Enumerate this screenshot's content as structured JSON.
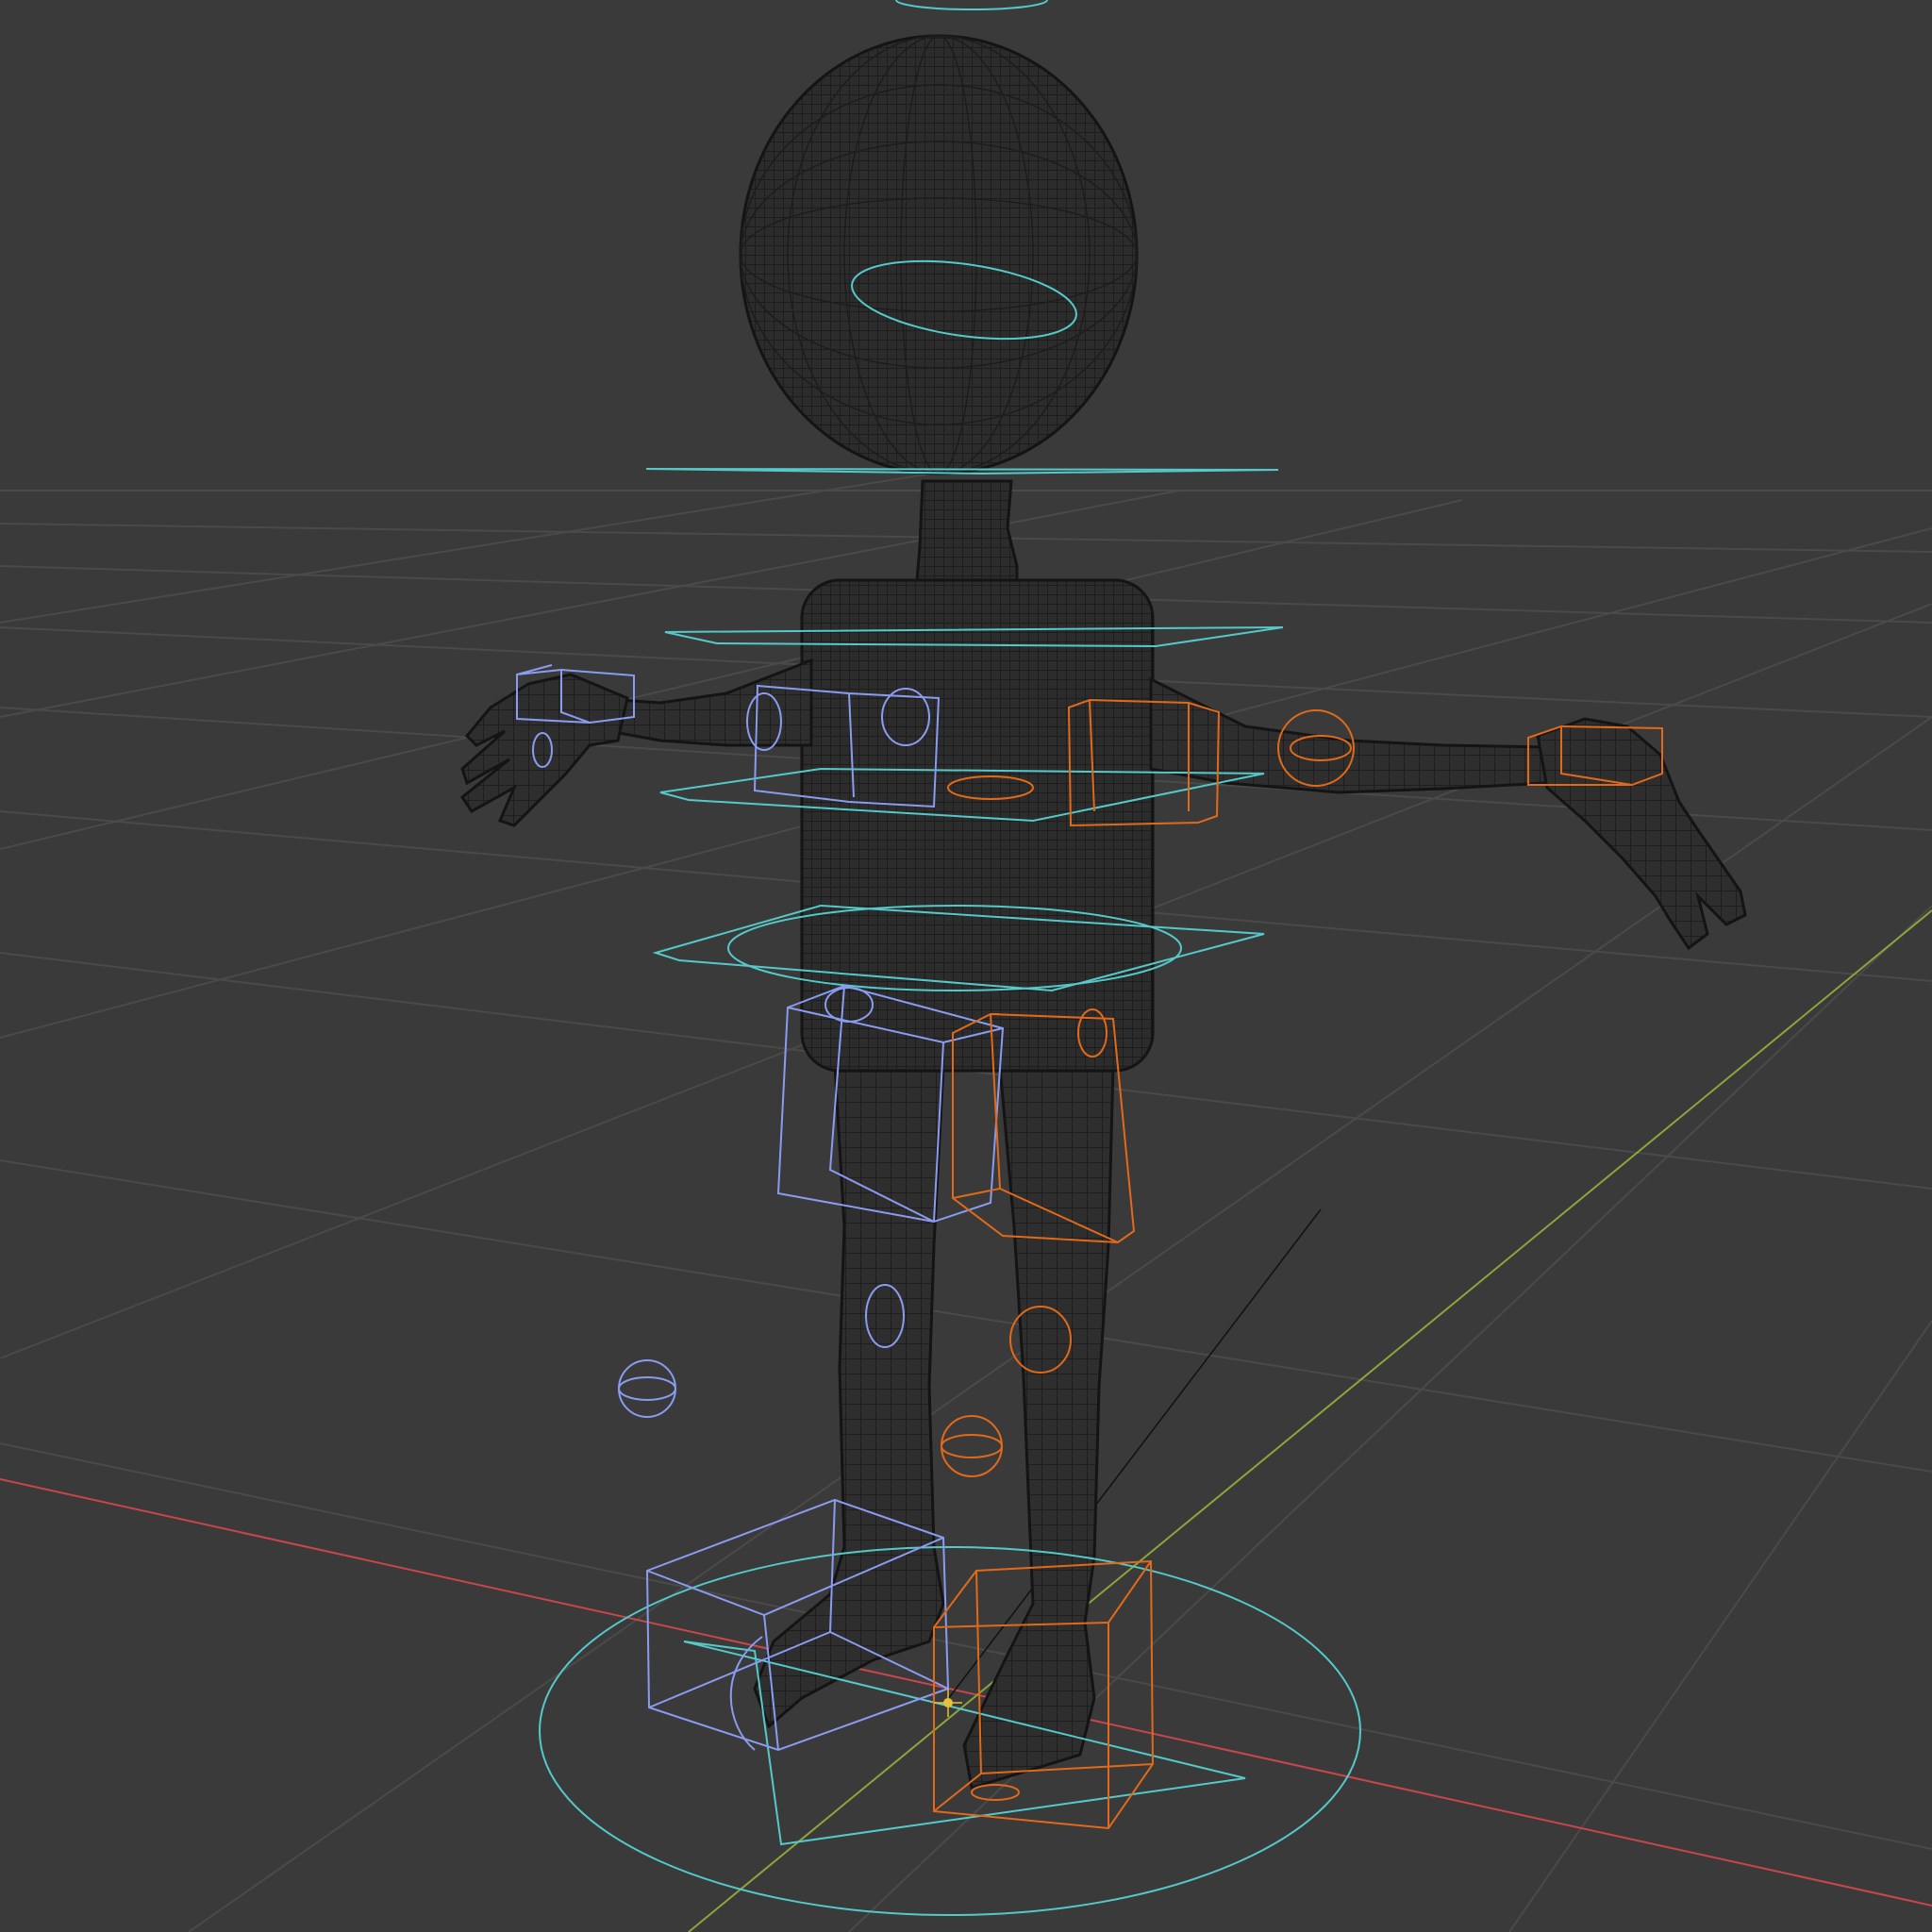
{
  "viewport": {
    "background": "#3a3a3a",
    "grid_color": "#4a4a4a",
    "axis_x_color": "#c8464c",
    "axis_y_color": "#8aa63a",
    "mesh_line_color": "#1c1c1c",
    "mesh_fill_color": "#2e2e2e",
    "controls": {
      "center_color": "#55c9c9",
      "left_color": "#8a9cf0",
      "right_color": "#e06a1a"
    }
  },
  "objects": [
    {
      "name": "character-mesh",
      "display": "wireframe"
    },
    {
      "name": "armature-controls",
      "display": "wire"
    }
  ],
  "icons": [
    "origin-icon",
    "bone-sphere-icon",
    "foot-ik-cube-icon"
  ]
}
